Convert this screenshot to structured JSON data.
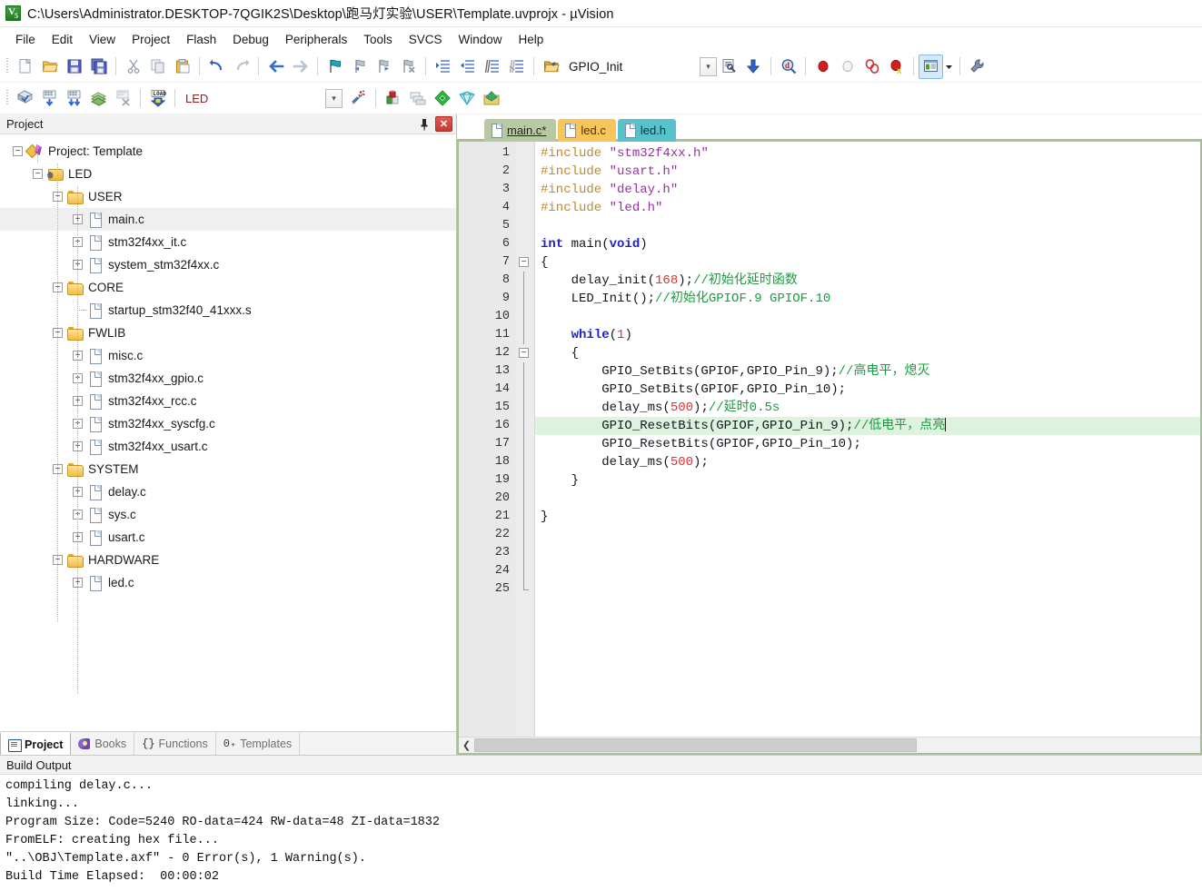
{
  "window": {
    "title": "C:\\Users\\Administrator.DESKTOP-7QGIK2S\\Desktop\\跑马灯实验\\USER\\Template.uvprojx - µVision",
    "app_icon": "uvision-icon"
  },
  "menu": {
    "items": [
      "File",
      "Edit",
      "View",
      "Project",
      "Flash",
      "Debug",
      "Peripherals",
      "Tools",
      "SVCS",
      "Window",
      "Help"
    ]
  },
  "toolbar_main": {
    "buttons": [
      {
        "name": "new-file-icon",
        "glyph": "new"
      },
      {
        "name": "open-file-icon",
        "glyph": "open"
      },
      {
        "name": "save-icon",
        "glyph": "save"
      },
      {
        "name": "save-all-icon",
        "glyph": "saveall"
      },
      {
        "name": "cut-icon",
        "glyph": "cut"
      },
      {
        "name": "copy-icon",
        "glyph": "copy"
      },
      {
        "name": "paste-icon",
        "glyph": "paste"
      },
      {
        "name": "undo-icon",
        "glyph": "undo"
      },
      {
        "name": "redo-icon",
        "glyph": "redo"
      },
      {
        "name": "navigate-back-icon",
        "glyph": "back"
      },
      {
        "name": "navigate-forward-icon",
        "glyph": "forward"
      },
      {
        "name": "bookmark-toggle-icon",
        "glyph": "bm"
      },
      {
        "name": "bookmark-prev-icon",
        "glyph": "bmprev"
      },
      {
        "name": "bookmark-next-icon",
        "glyph": "bmnext"
      },
      {
        "name": "bookmark-clear-icon",
        "glyph": "bmclear"
      },
      {
        "name": "indent-increase-icon",
        "glyph": "indent"
      },
      {
        "name": "indent-decrease-icon",
        "glyph": "outdent"
      },
      {
        "name": "comment-lines-icon",
        "glyph": "comment"
      },
      {
        "name": "uncomment-lines-icon",
        "glyph": "uncomment"
      }
    ],
    "function_browse_icon": "open-folder-icon",
    "function_name": "GPIO_Init",
    "right_buttons": [
      {
        "name": "configure-debug-icon"
      },
      {
        "name": "insert-include-icon"
      },
      {
        "name": "find-in-files-icon"
      },
      {
        "name": "breakpoint-insert-icon"
      },
      {
        "name": "breakpoint-disable-icon"
      },
      {
        "name": "breakpoint-kill-all-icon"
      },
      {
        "name": "breakpoint-disable-all-icon"
      },
      {
        "name": "window-layout-icon"
      },
      {
        "name": "configure-tools-icon"
      }
    ]
  },
  "toolbar_build": {
    "buttons": [
      {
        "name": "translate-file-icon"
      },
      {
        "name": "build-target-icon"
      },
      {
        "name": "rebuild-all-icon"
      },
      {
        "name": "batch-build-icon"
      },
      {
        "name": "stop-build-icon"
      },
      {
        "name": "download-icon"
      }
    ],
    "target_value": "LED",
    "target_placeholder": "Select Target",
    "after_buttons": [
      {
        "name": "target-options-icon"
      },
      {
        "name": "manage-project-items-icon"
      },
      {
        "name": "manage-multi-project-icon"
      },
      {
        "name": "pack-installer-icon"
      },
      {
        "name": "manage-runtime-env-icon"
      }
    ]
  },
  "project_panel": {
    "title": "Project",
    "pin_icon": "pin-icon",
    "close_icon": "close-icon",
    "tree": [
      {
        "label": "Project: Template",
        "icon": "project-icon",
        "depth": 0,
        "toggle": "minus",
        "selected": false
      },
      {
        "label": "LED",
        "icon": "target-icon",
        "depth": 1,
        "toggle": "minus",
        "selected": false
      },
      {
        "label": "USER",
        "icon": "folder-icon",
        "depth": 2,
        "toggle": "minus",
        "selected": false
      },
      {
        "label": "main.c",
        "icon": "file-icon",
        "depth": 3,
        "toggle": "plus",
        "selected": true
      },
      {
        "label": "stm32f4xx_it.c",
        "icon": "file-icon",
        "depth": 3,
        "toggle": "plus",
        "selected": false
      },
      {
        "label": "system_stm32f4xx.c",
        "icon": "file-icon",
        "depth": 3,
        "toggle": "plus",
        "selected": false
      },
      {
        "label": "CORE",
        "icon": "folder-icon",
        "depth": 2,
        "toggle": "minus",
        "selected": false
      },
      {
        "label": "startup_stm32f40_41xxx.s",
        "icon": "file-icon",
        "depth": 3,
        "toggle": "none",
        "selected": false
      },
      {
        "label": "FWLIB",
        "icon": "folder-icon",
        "depth": 2,
        "toggle": "minus",
        "selected": false
      },
      {
        "label": "misc.c",
        "icon": "file-icon",
        "depth": 3,
        "toggle": "plus",
        "selected": false
      },
      {
        "label": "stm32f4xx_gpio.c",
        "icon": "file-icon",
        "depth": 3,
        "toggle": "plus",
        "selected": false
      },
      {
        "label": "stm32f4xx_rcc.c",
        "icon": "file-icon",
        "depth": 3,
        "toggle": "plus",
        "selected": false
      },
      {
        "label": "stm32f4xx_syscfg.c",
        "icon": "file-icon",
        "depth": 3,
        "toggle": "plus",
        "selected": false
      },
      {
        "label": "stm32f4xx_usart.c",
        "icon": "file-icon",
        "depth": 3,
        "toggle": "plus",
        "selected": false
      },
      {
        "label": "SYSTEM",
        "icon": "folder-icon",
        "depth": 2,
        "toggle": "minus",
        "selected": false
      },
      {
        "label": "delay.c",
        "icon": "file-icon",
        "depth": 3,
        "toggle": "plus",
        "selected": false
      },
      {
        "label": "sys.c",
        "icon": "file-icon",
        "depth": 3,
        "toggle": "plus",
        "selected": false
      },
      {
        "label": "usart.c",
        "icon": "file-icon",
        "depth": 3,
        "toggle": "plus",
        "selected": false
      },
      {
        "label": "HARDWARE",
        "icon": "folder-icon",
        "depth": 2,
        "toggle": "minus",
        "selected": false
      },
      {
        "label": "led.c",
        "icon": "file-icon",
        "depth": 3,
        "toggle": "plus",
        "selected": false
      }
    ],
    "bottom_tabs": [
      {
        "label": "Project",
        "icon": "project-tab-icon",
        "selected": true
      },
      {
        "label": "Books",
        "icon": "books-icon",
        "selected": false
      },
      {
        "label": "Functions",
        "icon": "braces-icon",
        "selected": false
      },
      {
        "label": "Templates",
        "icon": "templates-icon",
        "selected": false
      }
    ]
  },
  "editor": {
    "tabs": [
      {
        "label": "main.c*",
        "state": "active",
        "color": "#b7c9a2"
      },
      {
        "label": "led.c",
        "state": "inactive",
        "color": "#f7c55c"
      },
      {
        "label": "led.h",
        "state": "inactive",
        "color": "#58c2cc"
      }
    ],
    "current_line": 16,
    "total_lines": 25,
    "scroll_left_icon": "chevron-left-icon",
    "lines": [
      {
        "n": 1,
        "tokens": [
          {
            "t": "#include ",
            "c": "pre"
          },
          {
            "t": "\"stm32f4xx.h\"",
            "c": "str"
          }
        ]
      },
      {
        "n": 2,
        "tokens": [
          {
            "t": "#include ",
            "c": "pre"
          },
          {
            "t": "\"usart.h\"",
            "c": "str"
          }
        ]
      },
      {
        "n": 3,
        "tokens": [
          {
            "t": "#include ",
            "c": "pre"
          },
          {
            "t": "\"delay.h\"",
            "c": "str"
          }
        ]
      },
      {
        "n": 4,
        "tokens": [
          {
            "t": "#include ",
            "c": "pre"
          },
          {
            "t": "\"led.h\"",
            "c": "str"
          }
        ]
      },
      {
        "n": 5,
        "tokens": []
      },
      {
        "n": 6,
        "tokens": [
          {
            "t": "int ",
            "c": "kw"
          },
          {
            "t": "main(",
            "c": ""
          },
          {
            "t": "void",
            "c": "kw"
          },
          {
            "t": ")",
            "c": ""
          }
        ]
      },
      {
        "n": 7,
        "tokens": [
          {
            "t": "{",
            "c": ""
          }
        ],
        "fold": "start"
      },
      {
        "n": 8,
        "tokens": [
          {
            "t": "    delay_init(",
            "c": ""
          },
          {
            "t": "168",
            "c": "num"
          },
          {
            "t": ");",
            "c": ""
          },
          {
            "t": "//初始化延时函数",
            "c": "cmt"
          }
        ]
      },
      {
        "n": 9,
        "tokens": [
          {
            "t": "    LED_Init();",
            "c": ""
          },
          {
            "t": "//初始化GPIOF.9 GPIOF.10",
            "c": "cmt"
          }
        ]
      },
      {
        "n": 10,
        "tokens": []
      },
      {
        "n": 11,
        "tokens": [
          {
            "t": "    ",
            "c": ""
          },
          {
            "t": "while",
            "c": "kw"
          },
          {
            "t": "(",
            "c": ""
          },
          {
            "t": "1",
            "c": "num"
          },
          {
            "t": ")",
            "c": ""
          }
        ]
      },
      {
        "n": 12,
        "tokens": [
          {
            "t": "    {",
            "c": ""
          }
        ],
        "fold": "start"
      },
      {
        "n": 13,
        "tokens": [
          {
            "t": "        GPIO_SetBits(GPIOF,GPIO_Pin_9);",
            "c": ""
          },
          {
            "t": "//高电平，熄灭",
            "c": "cmt"
          }
        ]
      },
      {
        "n": 14,
        "tokens": [
          {
            "t": "        GPIO_SetBits(GPIOF,GPIO_Pin_10);",
            "c": ""
          }
        ]
      },
      {
        "n": 15,
        "tokens": [
          {
            "t": "        delay_ms(",
            "c": ""
          },
          {
            "t": "500",
            "c": "num"
          },
          {
            "t": ");",
            "c": ""
          },
          {
            "t": "//延时0.5s",
            "c": "cmt"
          }
        ]
      },
      {
        "n": 16,
        "tokens": [
          {
            "t": "        GPIO_ResetBits(GPIOF,GPIO_Pin_9);",
            "c": ""
          },
          {
            "t": "//低电平，点亮",
            "c": "cmt"
          }
        ],
        "caret": true
      },
      {
        "n": 17,
        "tokens": [
          {
            "t": "        GPIO_ResetBits(GPIOF,GPIO_Pin_10);",
            "c": ""
          }
        ]
      },
      {
        "n": 18,
        "tokens": [
          {
            "t": "        delay_ms(",
            "c": ""
          },
          {
            "t": "500",
            "c": "num"
          },
          {
            "t": ");",
            "c": ""
          }
        ]
      },
      {
        "n": 19,
        "tokens": [
          {
            "t": "    }",
            "c": ""
          }
        ]
      },
      {
        "n": 20,
        "tokens": [],
        "fold": "end-inner"
      },
      {
        "n": 21,
        "tokens": [
          {
            "t": "}",
            "c": ""
          }
        ]
      },
      {
        "n": 22,
        "tokens": []
      },
      {
        "n": 23,
        "tokens": []
      },
      {
        "n": 24,
        "tokens": []
      },
      {
        "n": 25,
        "tokens": [],
        "fold": "end-outer"
      }
    ]
  },
  "build_output": {
    "title": "Build Output",
    "lines": [
      "compiling delay.c...",
      "linking...",
      "Program Size: Code=5240 RO-data=424 RW-data=48 ZI-data=1832",
      "FromELF: creating hex file...",
      "\"..\\OBJ\\Template.axf\" - 0 Error(s), 1 Warning(s).",
      "Build Time Elapsed:  00:00:02"
    ]
  },
  "colors": {
    "tab_active": "#b7c9a2",
    "tab_c": "#f7c55c",
    "tab_h": "#58c2cc",
    "current_line_highlight": "#ddf2df",
    "comment": "#179c3e",
    "string": "#9b2fa8",
    "keyword": "#2020d0",
    "number": "#e03030",
    "preprocessor": "#c08a2a",
    "editor_border": "#a9bf95"
  }
}
